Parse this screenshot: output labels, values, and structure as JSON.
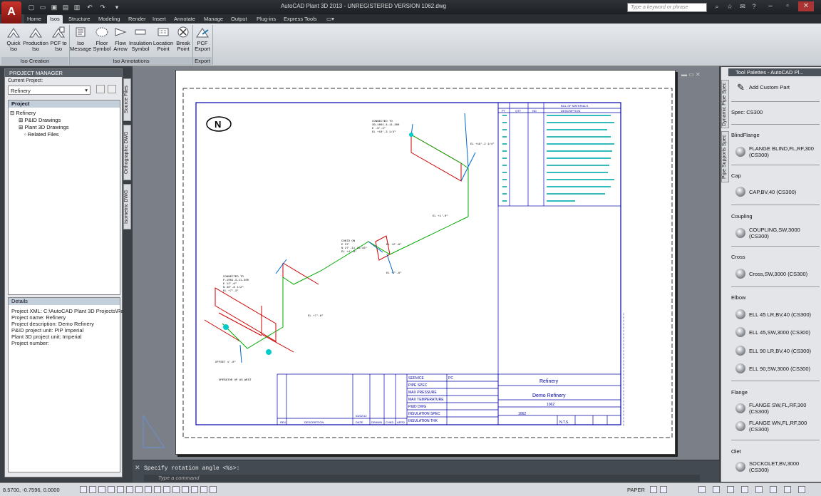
{
  "titlebar": {
    "title": "AutoCAD Plant 3D 2013 - UNREGISTERED VERSION    1062.dwg",
    "search_placeholder": "Type a keyword or phrase",
    "app_letter": "A"
  },
  "tabs": [
    "Home",
    "Isos",
    "Structure",
    "Modeling",
    "Render",
    "Insert",
    "Annotate",
    "Manage",
    "Output",
    "Plug-ins",
    "Express Tools"
  ],
  "active_tab": "Isos",
  "ribbon": {
    "iso_creation": {
      "label": "Iso Creation",
      "buttons": [
        {
          "label": "Quick\nIso"
        },
        {
          "label": "Production\nIso"
        },
        {
          "label": "PCF to\nIso"
        }
      ]
    },
    "iso_annotations": {
      "label": "Iso Annotations",
      "buttons": [
        {
          "label": "Iso\nMessage"
        },
        {
          "label": "Floor\nSymbol"
        },
        {
          "label": "Flow\nArrow"
        },
        {
          "label": "Insulation\nSymbol"
        },
        {
          "label": "Location\nPoint"
        },
        {
          "label": "Break\nPoint"
        }
      ]
    },
    "export": {
      "label": "Export",
      "buttons": [
        {
          "label": "PCF\nExport"
        }
      ]
    }
  },
  "project_manager": {
    "title": "PROJECT MANAGER",
    "current_project_label": "Current Project:",
    "current_project": "Refinery",
    "project_header": "Project",
    "tree": [
      "Refinery",
      "P&ID Drawings",
      "Plant 3D Drawings",
      "Related Files"
    ],
    "side_tabs": [
      "Source Files",
      "Orthographic DWG",
      "Isometric DWG"
    ],
    "details_header": "Details",
    "details": [
      "Project XML: C:\\AutoCAD Plant 3D Projects\\Re",
      "Project name: Refinery",
      "Project description: Demo Refinery",
      "P&ID project unit: PIP Imperial",
      "Plant 3D project unit: Imperial",
      "Project number:"
    ]
  },
  "drawing": {
    "title_block": {
      "project": "Refinery",
      "title": "Demo Refinery",
      "line_no": "1062",
      "scale": "N.T.S.",
      "date": "03/22/12"
    },
    "spec_rows": [
      "SERVICE",
      "PIPE SPEC",
      "MAX PRESSURE",
      "MAX TEMPERATURE",
      "P&ID DWG",
      "INSULATION SPEC",
      "INSULATION THK"
    ],
    "service_value": "PC",
    "rev_headers": [
      "REV",
      "DESCRIPTION",
      "DATE",
      "DRAWN",
      "CHKD",
      "APPD"
    ],
    "bom_title": "BILL OF MATERIALS",
    "bom_cols": [
      "PT",
      "QTY",
      "ND",
      "DESCRIPTION"
    ],
    "north": "N"
  },
  "command": {
    "history": "Specify rotation angle <%s>:",
    "prompt": "Type a command"
  },
  "palette": {
    "title": "Tool Palettes - AutoCAD Pl...",
    "side_tabs": [
      "Dynamic Pipe Spec",
      "Pipe Supports Spec"
    ],
    "add_custom": "Add Custom Part",
    "spec": "Spec: CS300",
    "categories": [
      {
        "name": "BlindFlange",
        "items": [
          "FLANGE BLIND,FL,RF,300\n(CS300)"
        ]
      },
      {
        "name": "Cap",
        "items": [
          "CAP,BV,40 (CS300)"
        ]
      },
      {
        "name": "Coupling",
        "items": [
          "COUPLING,SW,3000\n(CS300)"
        ]
      },
      {
        "name": "Cross",
        "items": [
          "Cross,SW,3000 (CS300)"
        ]
      },
      {
        "name": "Elbow",
        "items": [
          "ELL 45 LR,BV,40 (CS300)",
          "ELL 45,SW,3000 (CS300)",
          "ELL 90 LR,BV,40 (CS300)",
          "ELL 90,SW,3000 (CS300)"
        ]
      },
      {
        "name": "Flange",
        "items": [
          "FLANGE SW,FL,RF,300\n(CS300)",
          "FLANGE WN,FL,RF,300\n(CS300)"
        ]
      },
      {
        "name": "Olet",
        "items": [
          "SOCKOLET,BV,3000\n(CS300)"
        ]
      }
    ]
  },
  "status": {
    "coords": "8.5700, -0.7596, 0.0000",
    "paper": "PAPER"
  }
}
